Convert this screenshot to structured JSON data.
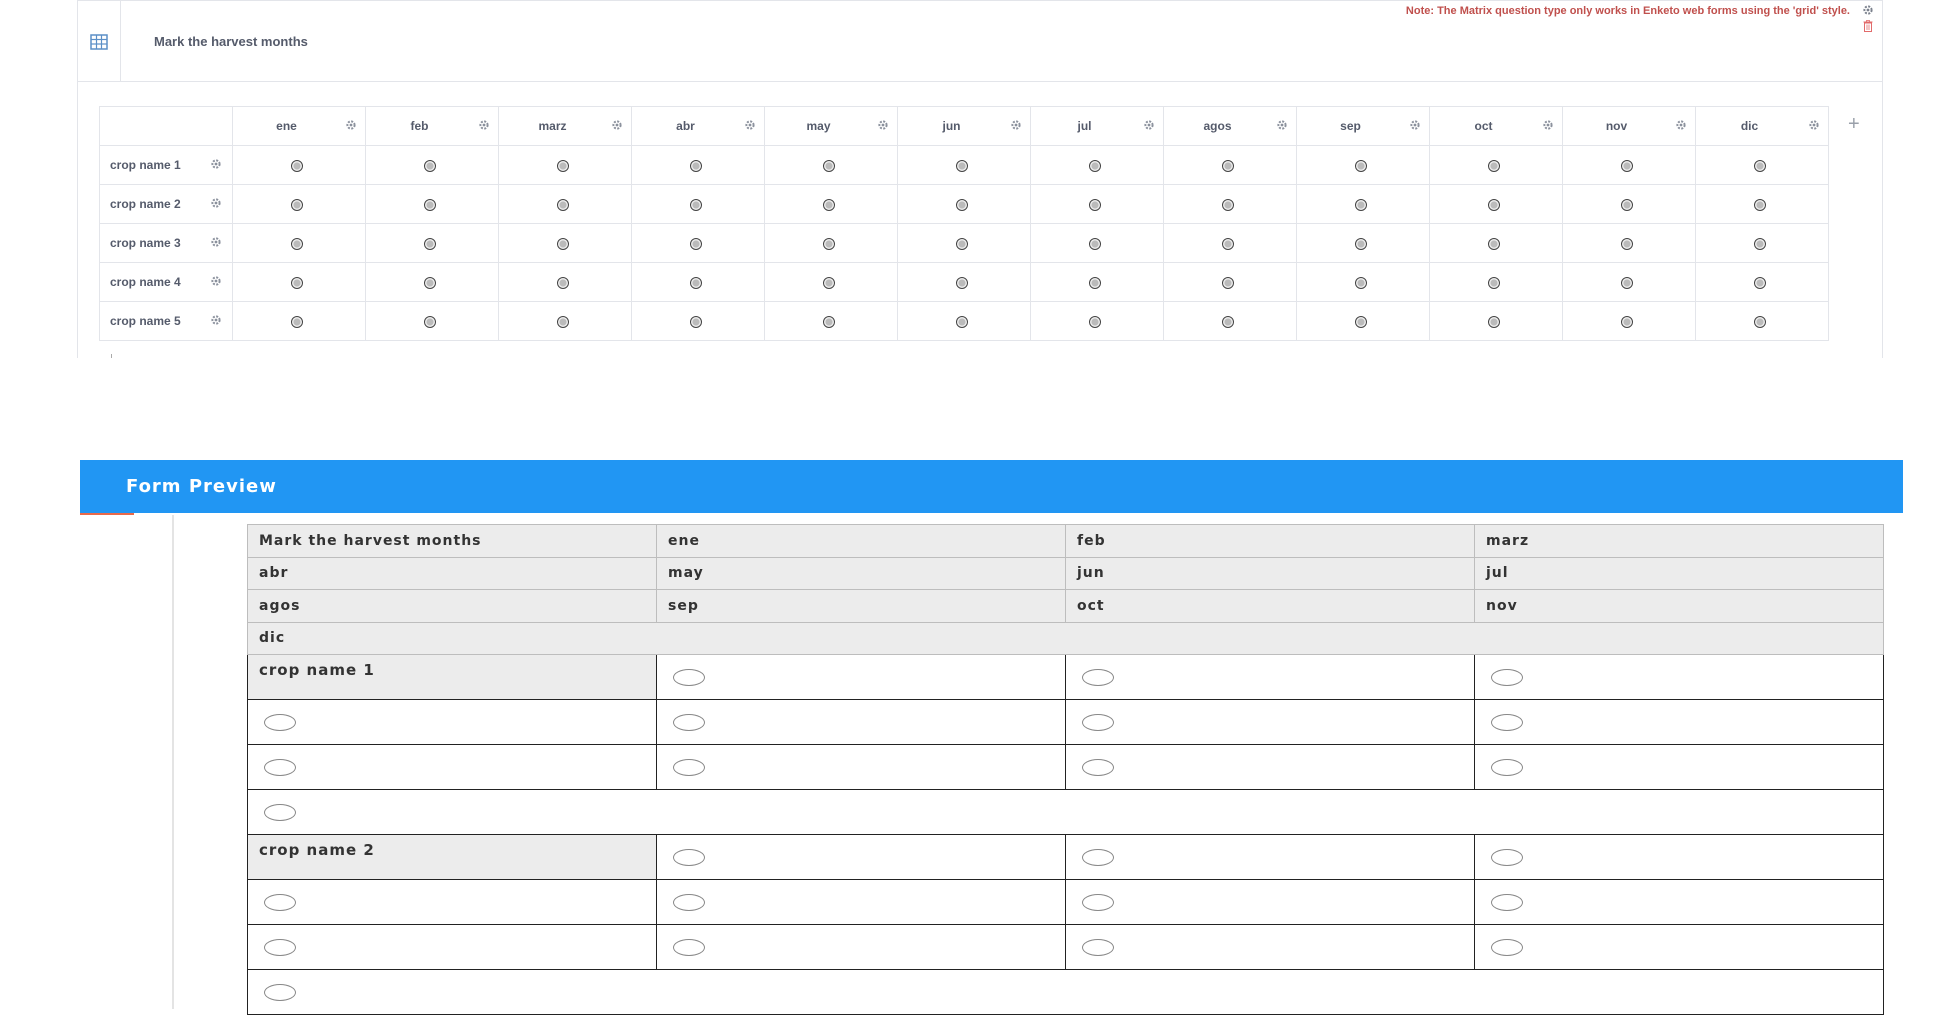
{
  "editor": {
    "question_label": "Mark the harvest months",
    "note": "Note: The Matrix question type only works in Enketo web forms using the 'grid' style.",
    "columns": [
      "ene",
      "feb",
      "marz",
      "abr",
      "may",
      "jun",
      "jul",
      "agos",
      "sep",
      "oct",
      "nov",
      "dic"
    ],
    "rows": [
      "crop name 1",
      "crop name 2",
      "crop name 3",
      "crop name 4",
      "crop name 5"
    ],
    "icons": {
      "type": "grid-table-icon",
      "settings": "gear-icon",
      "delete": "trash-icon",
      "add_column": "plus-icon"
    },
    "add_column_symbol": "+",
    "colors": {
      "note": "#c0504d",
      "border": "#e3e5ea"
    }
  },
  "preview": {
    "title": "Form Preview",
    "header_rows": [
      [
        "Mark the harvest months",
        "ene",
        "feb",
        "marz"
      ],
      [
        "abr",
        "may",
        "jun",
        "jul"
      ],
      [
        "agos",
        "sep",
        "oct",
        "nov"
      ],
      [
        "dic"
      ]
    ],
    "crops": [
      "crop name 1",
      "crop name 2"
    ],
    "colors": {
      "bar": "#2196f3",
      "accent": "#e8694a"
    }
  }
}
